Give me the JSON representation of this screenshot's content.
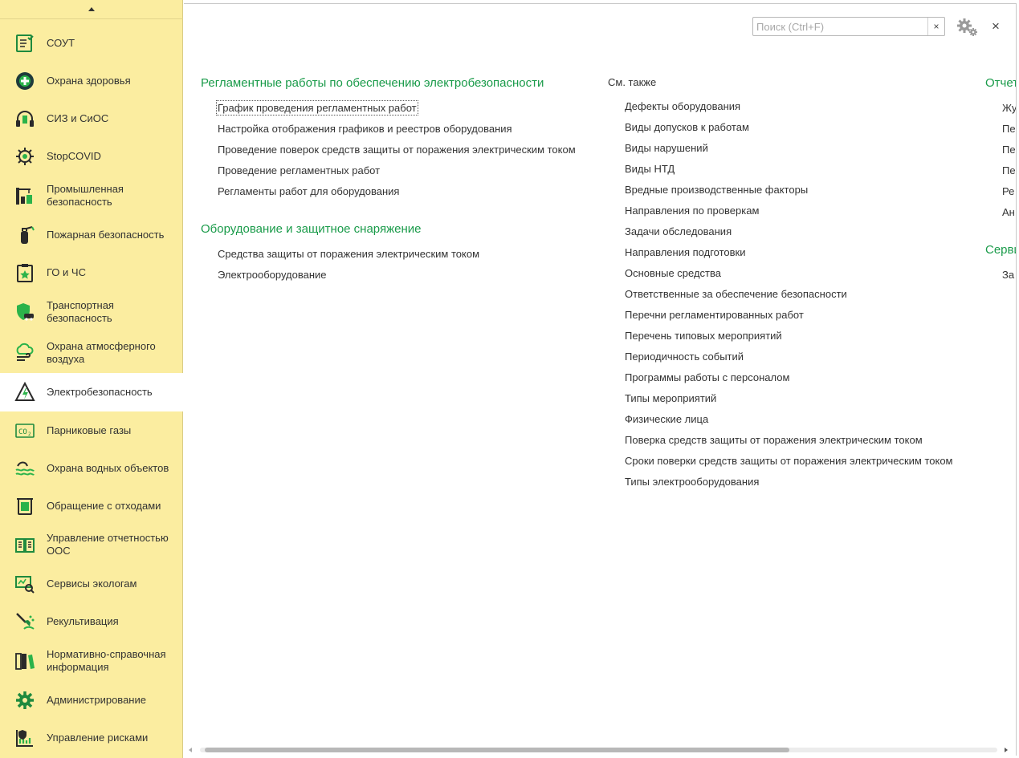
{
  "colors": {
    "sidebar_bg": "#fbeda0",
    "active_item_bg": "#ffffff",
    "section_title": "#1a9b4a",
    "icon_green": "#1e8a3e"
  },
  "sidebar": {
    "items": [
      {
        "label": "СОУТ",
        "icon": "checklist-icon"
      },
      {
        "label": "Охрана здоровья",
        "icon": "medical-cross-icon"
      },
      {
        "label": "СИЗ и СиОС",
        "icon": "headphones-glove-icon"
      },
      {
        "label": "StopCOVID",
        "icon": "virus-icon"
      },
      {
        "label": "Промышленная безопасность",
        "icon": "crane-icon"
      },
      {
        "label": "Пожарная безопасность",
        "icon": "fire-extinguisher-icon"
      },
      {
        "label": "ГО и ЧС",
        "icon": "clipboard-star-icon"
      },
      {
        "label": "Транспортная безопасность",
        "icon": "shield-car-icon"
      },
      {
        "label": "Охрана атмосферного воздуха",
        "icon": "cloud-wind-icon"
      },
      {
        "label": "Электробезопасность",
        "icon": "electric-hazard-icon",
        "active": true
      },
      {
        "label": "Парниковые газы",
        "icon": "co2-icon"
      },
      {
        "label": "Охрана водных объектов",
        "icon": "water-waves-icon"
      },
      {
        "label": "Обращение с отходами",
        "icon": "waste-container-icon"
      },
      {
        "label": "Управление отчетностью ООС",
        "icon": "report-book-icon"
      },
      {
        "label": "Сервисы экологам",
        "icon": "monitor-search-icon"
      },
      {
        "label": "Рекультивация",
        "icon": "shovel-icon"
      },
      {
        "label": "Нормативно-справочная информация",
        "icon": "binders-icon"
      },
      {
        "label": "Администрирование",
        "icon": "gear-icon"
      },
      {
        "label": "Управление рисками",
        "icon": "risk-chart-icon"
      }
    ]
  },
  "search": {
    "placeholder": "Поиск (Ctrl+F)",
    "value": "",
    "clear_label": "×"
  },
  "close_label": "×",
  "section1": {
    "title": "Регламентные работы по обеспечению электробезопасности",
    "links": [
      "График проведения регламентных работ",
      "Настройка отображения графиков и реестров оборудования",
      "Проведение поверок средств защиты от поражения электрическим током",
      "Проведение регламентных работ",
      "Регламенты работ для оборудования"
    ]
  },
  "section2": {
    "title": "Оборудование и защитное снаряжение",
    "links": [
      "Средства защиты от поражения электрическим током",
      "Электрооборудование"
    ]
  },
  "see_also": {
    "title": "См. также",
    "links": [
      "Дефекты оборудования",
      "Виды допусков к работам",
      "Виды нарушений",
      "Виды НТД",
      "Вредные производственные факторы",
      "Направления по проверкам",
      "Задачи обследования",
      "Направления подготовки",
      "Основные средства",
      "Ответственные за обеспечение безопасности",
      "Перечни регламентированных работ",
      "Перечень типовых мероприятий",
      "Периодичность событий",
      "Программы работы с персоналом",
      "Типы мероприятий",
      "Физические лица",
      "Поверка средств защиты от поражения электрическим током",
      "Сроки поверки средств защиты от поражения электрическим током",
      "Типы электрооборудования"
    ]
  },
  "reports": {
    "title": "Отчеты",
    "links": [
      "Жу",
      "Пе",
      "Пе",
      "Пе",
      "Ре",
      "Ан"
    ]
  },
  "services": {
    "title": "Сервис",
    "links": [
      "За"
    ]
  }
}
